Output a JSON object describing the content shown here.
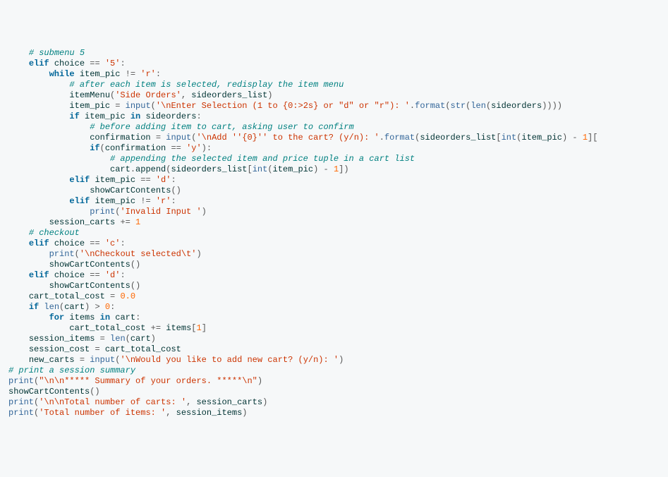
{
  "lines": [
    [
      [
        "    ",
        ""
      ],
      [
        "# submenu 5",
        "cm"
      ]
    ],
    [
      [
        "    ",
        ""
      ],
      [
        "elif",
        "kw"
      ],
      [
        " ",
        ""
      ],
      [
        "choice",
        "id"
      ],
      [
        " ",
        ""
      ],
      [
        "==",
        "op"
      ],
      [
        " ",
        ""
      ],
      [
        "'5'",
        "st"
      ],
      [
        ":",
        "op"
      ]
    ],
    [
      [
        "        ",
        ""
      ],
      [
        "while",
        "kw"
      ],
      [
        " ",
        ""
      ],
      [
        "item_pic",
        "id"
      ],
      [
        " ",
        ""
      ],
      [
        "!=",
        "op"
      ],
      [
        " ",
        ""
      ],
      [
        "'r'",
        "st"
      ],
      [
        ":",
        "op"
      ]
    ],
    [
      [
        "            ",
        ""
      ],
      [
        "# after each item is selected, redisplay the item menu",
        "cm"
      ]
    ],
    [
      [
        "            ",
        ""
      ],
      [
        "itemMenu",
        "id"
      ],
      [
        "(",
        "op"
      ],
      [
        "'Side Orders'",
        "st"
      ],
      [
        ", ",
        "op"
      ],
      [
        "sideorders_list",
        "id"
      ],
      [
        ")",
        "op"
      ]
    ],
    [
      [
        "            ",
        ""
      ],
      [
        "item_pic",
        "id"
      ],
      [
        " ",
        ""
      ],
      [
        "=",
        "op"
      ],
      [
        " ",
        ""
      ],
      [
        "input",
        "fn"
      ],
      [
        "(",
        "op"
      ],
      [
        "'\\nEnter Selection (1 to {0:>2s} or \"d\" or \"r\"): '",
        "st"
      ],
      [
        ".",
        "op"
      ],
      [
        "format",
        "fn"
      ],
      [
        "(",
        "op"
      ],
      [
        "str",
        "fn"
      ],
      [
        "(",
        "op"
      ],
      [
        "len",
        "fn"
      ],
      [
        "(",
        "op"
      ],
      [
        "sideorders",
        "id"
      ],
      [
        "))))",
        "op"
      ]
    ],
    [
      [
        "            ",
        ""
      ],
      [
        "if",
        "kw"
      ],
      [
        " ",
        ""
      ],
      [
        "item_pic",
        "id"
      ],
      [
        " ",
        ""
      ],
      [
        "in",
        "kw"
      ],
      [
        " ",
        ""
      ],
      [
        "sideorders",
        "id"
      ],
      [
        ":",
        "op"
      ]
    ],
    [
      [
        "                ",
        ""
      ],
      [
        "# before adding item to cart, asking user to confirm",
        "cm"
      ]
    ],
    [
      [
        "                ",
        ""
      ],
      [
        "confirmation",
        "id"
      ],
      [
        " ",
        ""
      ],
      [
        "=",
        "op"
      ],
      [
        " ",
        ""
      ],
      [
        "input",
        "fn"
      ],
      [
        "(",
        "op"
      ],
      [
        "'\\nAdd ''{0}'' to the cart? (y/n): '",
        "st"
      ],
      [
        ".",
        "op"
      ],
      [
        "format",
        "fn"
      ],
      [
        "(",
        "op"
      ],
      [
        "sideorders_list",
        "id"
      ],
      [
        "[",
        "op"
      ],
      [
        "int",
        "fn"
      ],
      [
        "(",
        "op"
      ],
      [
        "item_pic",
        "id"
      ],
      [
        ") ",
        "op"
      ],
      [
        "-",
        "op"
      ],
      [
        " ",
        ""
      ],
      [
        "1",
        "nm"
      ],
      [
        "][",
        "op"
      ]
    ],
    [
      [
        "                ",
        ""
      ],
      [
        "if",
        "kw"
      ],
      [
        "(",
        "op"
      ],
      [
        "confirmation",
        "id"
      ],
      [
        " ",
        ""
      ],
      [
        "==",
        "op"
      ],
      [
        " ",
        ""
      ],
      [
        "'y'",
        "st"
      ],
      [
        "):",
        "op"
      ]
    ],
    [
      [
        "                    ",
        ""
      ],
      [
        "# appending the selected item and price tuple in a cart list",
        "cm"
      ]
    ],
    [
      [
        "                    ",
        ""
      ],
      [
        "cart",
        "id"
      ],
      [
        ".",
        "op"
      ],
      [
        "append",
        "id"
      ],
      [
        "(",
        "op"
      ],
      [
        "sideorders_list",
        "id"
      ],
      [
        "[",
        "op"
      ],
      [
        "int",
        "fn"
      ],
      [
        "(",
        "op"
      ],
      [
        "item_pic",
        "id"
      ],
      [
        ") ",
        "op"
      ],
      [
        "-",
        "op"
      ],
      [
        " ",
        ""
      ],
      [
        "1",
        "nm"
      ],
      [
        "])",
        "op"
      ]
    ],
    [
      [
        "            ",
        ""
      ],
      [
        "elif",
        "kw"
      ],
      [
        " ",
        ""
      ],
      [
        "item_pic",
        "id"
      ],
      [
        " ",
        ""
      ],
      [
        "==",
        "op"
      ],
      [
        " ",
        ""
      ],
      [
        "'d'",
        "st"
      ],
      [
        ":",
        "op"
      ]
    ],
    [
      [
        "                ",
        ""
      ],
      [
        "showCartContents",
        "id"
      ],
      [
        "()",
        "op"
      ]
    ],
    [
      [
        "            ",
        ""
      ],
      [
        "elif",
        "kw"
      ],
      [
        " ",
        ""
      ],
      [
        "item_pic",
        "id"
      ],
      [
        " ",
        ""
      ],
      [
        "!=",
        "op"
      ],
      [
        " ",
        ""
      ],
      [
        "'r'",
        "st"
      ],
      [
        ":",
        "op"
      ]
    ],
    [
      [
        "                ",
        ""
      ],
      [
        "print",
        "fn"
      ],
      [
        "(",
        "op"
      ],
      [
        "'Invalid Input '",
        "st"
      ],
      [
        ")",
        "op"
      ]
    ],
    [
      [
        "        ",
        ""
      ],
      [
        "session_carts",
        "id"
      ],
      [
        " ",
        ""
      ],
      [
        "+=",
        "op"
      ],
      [
        " ",
        ""
      ],
      [
        "1",
        "nm"
      ]
    ],
    [
      [
        "",
        ""
      ]
    ],
    [
      [
        "    ",
        ""
      ],
      [
        "# checkout",
        "cm"
      ]
    ],
    [
      [
        "    ",
        ""
      ],
      [
        "elif",
        "kw"
      ],
      [
        " ",
        ""
      ],
      [
        "choice",
        "id"
      ],
      [
        " ",
        ""
      ],
      [
        "==",
        "op"
      ],
      [
        " ",
        ""
      ],
      [
        "'c'",
        "st"
      ],
      [
        ":",
        "op"
      ]
    ],
    [
      [
        "        ",
        ""
      ],
      [
        "print",
        "fn"
      ],
      [
        "(",
        "op"
      ],
      [
        "'\\nCheckout selected\\t'",
        "st"
      ],
      [
        ")",
        "op"
      ]
    ],
    [
      [
        "        ",
        ""
      ],
      [
        "showCartContents",
        "id"
      ],
      [
        "()",
        "op"
      ]
    ],
    [
      [
        "    ",
        ""
      ],
      [
        "elif",
        "kw"
      ],
      [
        " ",
        ""
      ],
      [
        "choice",
        "id"
      ],
      [
        " ",
        ""
      ],
      [
        "==",
        "op"
      ],
      [
        " ",
        ""
      ],
      [
        "'d'",
        "st"
      ],
      [
        ":",
        "op"
      ]
    ],
    [
      [
        "        ",
        ""
      ],
      [
        "showCartContents",
        "id"
      ],
      [
        "()",
        "op"
      ]
    ],
    [
      [
        "",
        ""
      ]
    ],
    [
      [
        "    ",
        ""
      ],
      [
        "cart_total_cost",
        "id"
      ],
      [
        " ",
        ""
      ],
      [
        "=",
        "op"
      ],
      [
        " ",
        ""
      ],
      [
        "0.0",
        "nm"
      ]
    ],
    [
      [
        "    ",
        ""
      ],
      [
        "if",
        "kw"
      ],
      [
        " ",
        ""
      ],
      [
        "len",
        "fn"
      ],
      [
        "(",
        "op"
      ],
      [
        "cart",
        "id"
      ],
      [
        ") ",
        "op"
      ],
      [
        ">",
        "op"
      ],
      [
        " ",
        ""
      ],
      [
        "0",
        "nm"
      ],
      [
        ":",
        "op"
      ]
    ],
    [
      [
        "        ",
        ""
      ],
      [
        "for",
        "kw"
      ],
      [
        " ",
        ""
      ],
      [
        "items",
        "id"
      ],
      [
        " ",
        ""
      ],
      [
        "in",
        "kw"
      ],
      [
        " ",
        ""
      ],
      [
        "cart",
        "id"
      ],
      [
        ":",
        "op"
      ]
    ],
    [
      [
        "            ",
        ""
      ],
      [
        "cart_total_cost",
        "id"
      ],
      [
        " ",
        ""
      ],
      [
        "+=",
        "op"
      ],
      [
        " ",
        ""
      ],
      [
        "items",
        "id"
      ],
      [
        "[",
        "op"
      ],
      [
        "1",
        "nm"
      ],
      [
        "]",
        "op"
      ]
    ],
    [
      [
        "    ",
        ""
      ],
      [
        "session_items",
        "id"
      ],
      [
        " ",
        ""
      ],
      [
        "=",
        "op"
      ],
      [
        " ",
        ""
      ],
      [
        "len",
        "fn"
      ],
      [
        "(",
        "op"
      ],
      [
        "cart",
        "id"
      ],
      [
        ")",
        "op"
      ]
    ],
    [
      [
        "    ",
        ""
      ],
      [
        "session_cost",
        "id"
      ],
      [
        " ",
        ""
      ],
      [
        "=",
        "op"
      ],
      [
        " ",
        ""
      ],
      [
        "cart_total_cost",
        "id"
      ]
    ],
    [
      [
        "",
        ""
      ]
    ],
    [
      [
        "    ",
        ""
      ],
      [
        "new_carts",
        "id"
      ],
      [
        " ",
        ""
      ],
      [
        "=",
        "op"
      ],
      [
        " ",
        ""
      ],
      [
        "input",
        "fn"
      ],
      [
        "(",
        "op"
      ],
      [
        "'\\nWould you like to add new cart? (y/n): '",
        "st"
      ],
      [
        ")",
        "op"
      ]
    ],
    [
      [
        "",
        ""
      ]
    ],
    [
      [
        "# print a session summary",
        "cm"
      ]
    ],
    [
      [
        "print",
        "fn"
      ],
      [
        "(",
        "op"
      ],
      [
        "\"\\n\\n***** Summary of your orders. *****\\n\"",
        "st"
      ],
      [
        ")",
        "op"
      ]
    ],
    [
      [
        "showCartContents",
        "id"
      ],
      [
        "()",
        "op"
      ]
    ],
    [
      [
        "print",
        "fn"
      ],
      [
        "(",
        "op"
      ],
      [
        "'\\n\\nTotal number of carts: '",
        "st"
      ],
      [
        ", ",
        "op"
      ],
      [
        "session_carts",
        "id"
      ],
      [
        ")",
        "op"
      ]
    ],
    [
      [
        "print",
        "fn"
      ],
      [
        "(",
        "op"
      ],
      [
        "'Total number of items: '",
        "st"
      ],
      [
        ", ",
        "op"
      ],
      [
        "session_items",
        "id"
      ],
      [
        ")",
        "op"
      ]
    ]
  ]
}
